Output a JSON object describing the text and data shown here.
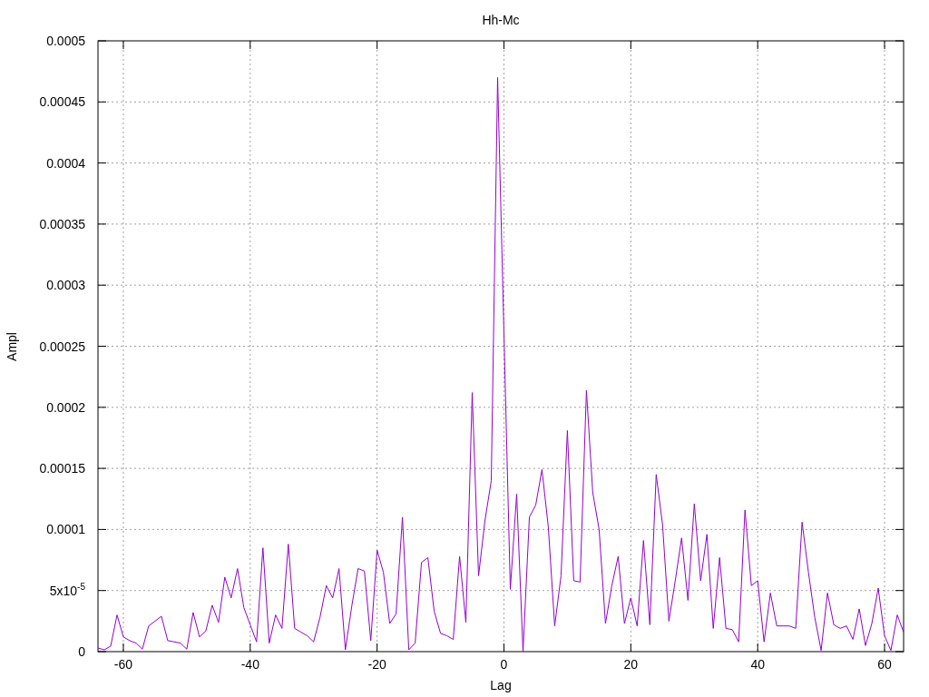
{
  "chart_data": {
    "type": "line",
    "title": "Hh-Mc",
    "xlabel": "Lag",
    "ylabel": "Ampl",
    "grid": true,
    "xlim": [
      -64,
      63
    ],
    "ylim": [
      0,
      0.0005
    ],
    "xticks": [
      -60,
      -40,
      -20,
      0,
      20,
      40,
      60
    ],
    "yticks": [
      {
        "value": 0,
        "label": "0"
      },
      {
        "value": 5e-05,
        "label": "5x10$^{-5}$"
      },
      {
        "value": 0.0001,
        "label": "0.0001"
      },
      {
        "value": 0.00015,
        "label": "0.00015"
      },
      {
        "value": 0.0002,
        "label": "0.0002"
      },
      {
        "value": 0.00025,
        "label": "0.00025"
      },
      {
        "value": 0.0003,
        "label": "0.0003"
      },
      {
        "value": 0.00035,
        "label": "0.00035"
      },
      {
        "value": 0.0004,
        "label": "0.0004"
      },
      {
        "value": 0.00045,
        "label": "0.00045"
      },
      {
        "value": 0.0005,
        "label": "0.0005"
      }
    ],
    "x": [
      -64,
      -63,
      -62,
      -61,
      -60,
      -59,
      -58,
      -57,
      -56,
      -55,
      -54,
      -53,
      -52,
      -51,
      -50,
      -49,
      -48,
      -47,
      -46,
      -45,
      -44,
      -43,
      -42,
      -41,
      -40,
      -39,
      -38,
      -37,
      -36,
      -35,
      -34,
      -33,
      -32,
      -31,
      -30,
      -29,
      -28,
      -27,
      -26,
      -25,
      -24,
      -23,
      -22,
      -21,
      -20,
      -19,
      -18,
      -17,
      -16,
      -15,
      -14,
      -13,
      -12,
      -11,
      -10,
      -9,
      -8,
      -7,
      -6,
      -5,
      -4,
      -3,
      -2,
      -1,
      0,
      1,
      2,
      3,
      4,
      5,
      6,
      7,
      8,
      9,
      10,
      11,
      12,
      13,
      14,
      15,
      16,
      17,
      18,
      19,
      20,
      21,
      22,
      23,
      24,
      25,
      26,
      27,
      28,
      29,
      30,
      31,
      32,
      33,
      34,
      35,
      36,
      37,
      38,
      39,
      40,
      41,
      42,
      43,
      44,
      45,
      46,
      47,
      48,
      49,
      50,
      51,
      52,
      53,
      54,
      55,
      56,
      57,
      58,
      59,
      60,
      61,
      62,
      63
    ],
    "series": [
      {
        "color": "#9400d3",
        "values": [
          3e-06,
          1.5e-06,
          4.5e-06,
          3e-05,
          1.2e-05,
          9e-06,
          7e-06,
          2e-06,
          2.1e-05,
          2.5e-05,
          2.9e-05,
          9e-06,
          8e-06,
          7e-06,
          2e-06,
          3.2e-05,
          1.2e-05,
          1.7e-05,
          3.8e-05,
          2.4e-05,
          6.1e-05,
          4.4e-05,
          6.8e-05,
          3.6e-05,
          2.2e-05,
          8e-06,
          8.5e-05,
          7e-06,
          3e-05,
          1.9e-05,
          8.8e-05,
          1.9e-05,
          1.6e-05,
          1.3e-05,
          8e-06,
          2.8e-05,
          5.4e-05,
          4.4e-05,
          6.8e-05,
          1.5e-06,
          3.7e-05,
          6.8e-05,
          6.6e-05,
          9e-06,
          8.3e-05,
          6.5e-05,
          2.3e-05,
          3.1e-05,
          0.00011,
          1.5e-06,
          7e-06,
          7.3e-05,
          7.7e-05,
          3.3e-05,
          1.5e-05,
          1.3e-05,
          1e-05,
          7.8e-05,
          2.4e-05,
          0.000212,
          6.2e-05,
          0.000107,
          0.00014,
          0.00047,
          0.00026,
          5.1e-05,
          0.000129,
          0,
          0.00011,
          0.00012,
          0.000149,
          0.000102,
          2.1e-05,
          6.2e-05,
          0.000181,
          5.8e-05,
          5.7e-05,
          0.000214,
          0.00013,
          0.0001,
          2.3e-05,
          5.4e-05,
          7.8e-05,
          2.3e-05,
          4.4e-05,
          2.1e-05,
          9.1e-05,
          2.2e-05,
          0.000145,
          0.000104,
          2.5e-05,
          5.8e-05,
          9.3e-05,
          4.2e-05,
          0.000121,
          5.8e-05,
          9.6e-05,
          1.9e-05,
          7.7e-05,
          1.9e-05,
          1.8e-05,
          8e-06,
          0.000116,
          5.4e-05,
          5.8e-05,
          8e-06,
          4.8e-05,
          2.1e-05,
          2.1e-05,
          2.1e-05,
          1.9e-05,
          0.000106,
          6.5e-05,
          2.8e-05,
          1e-06,
          4.8e-05,
          2.2e-05,
          1.9e-05,
          2.1e-05,
          1e-05,
          3.5e-05,
          5e-06,
          2.3e-05,
          5.2e-05,
          1.3e-05,
          1e-06,
          3e-05,
          1.6e-05
        ]
      }
    ]
  }
}
